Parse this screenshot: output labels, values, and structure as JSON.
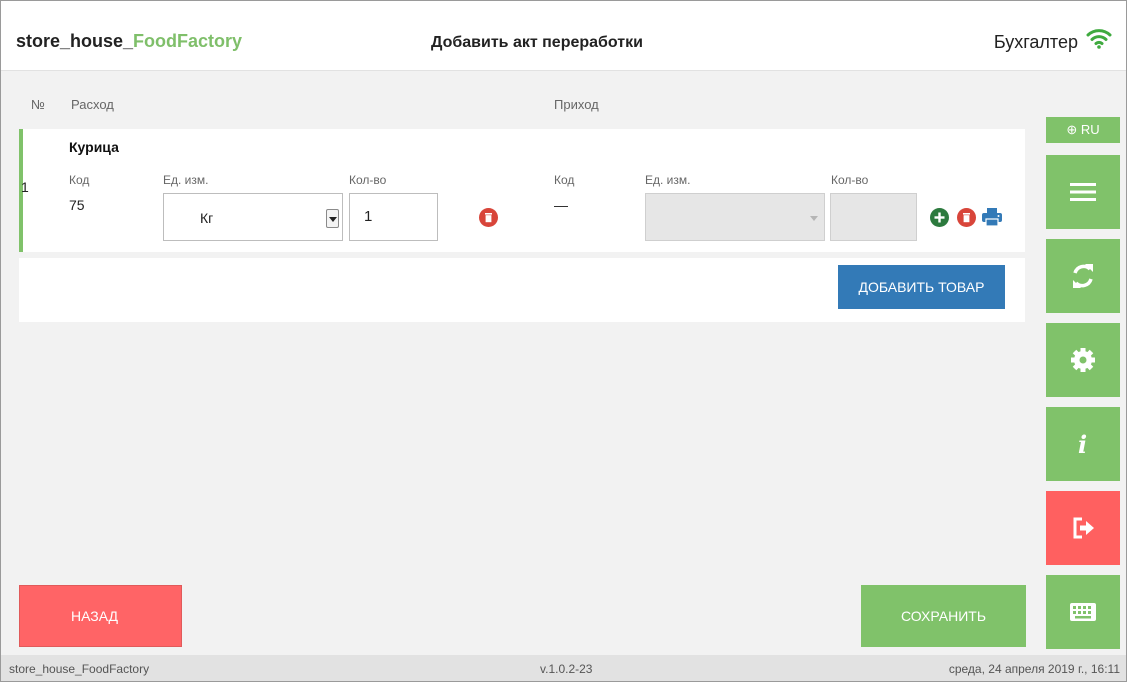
{
  "header": {
    "brand_prefix": "store_house_",
    "brand_accent": "FoodFactory",
    "title": "Добавить акт переработки",
    "user_role": "Бухгалтер",
    "wifi_icon": "wifi-icon"
  },
  "columns": {
    "num": "№",
    "expense": "Расход",
    "income": "Приход"
  },
  "row": {
    "number": "1",
    "product": "Курица",
    "expense": {
      "code_label": "Код",
      "code_value": "75",
      "unit_label": "Ед. изм.",
      "unit_value": "Кг",
      "qty_label": "Кол-во",
      "qty_value": "1"
    },
    "income": {
      "code_label": "Код",
      "code_value": "—",
      "unit_label": "Ед. изм.",
      "unit_value": "",
      "qty_label": "Кол-во",
      "qty_value": ""
    }
  },
  "actions": {
    "add_product": "Добавить товар",
    "back": "Назад",
    "save": "Сохранить"
  },
  "sidebar": {
    "lang": "RU",
    "icons": [
      "globe-icon",
      "menu-icon",
      "sync-icon",
      "gear-icon",
      "info-icon",
      "logout-icon",
      "keyboard-icon"
    ]
  },
  "status": {
    "app_name": "store_house_FoodFactory",
    "version": "v.1.0.2-23",
    "datetime": "среда, 24 апреля 2019 г., 16:11"
  },
  "colors": {
    "green": "#80c26a",
    "blue": "#337ab7",
    "red": "#ff6466",
    "dark_red": "#d8453a",
    "dark_green": "#2c7a3e"
  }
}
